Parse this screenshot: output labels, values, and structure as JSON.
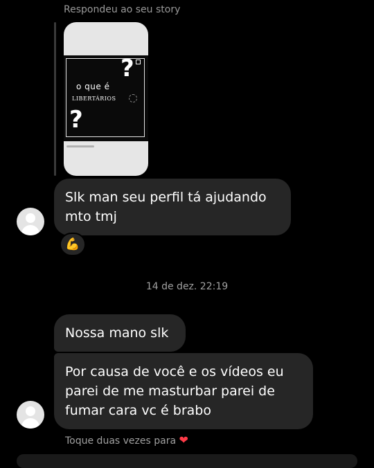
{
  "reply": {
    "label": "Respondeu ao seu story"
  },
  "story": {
    "line1": "o que é",
    "line2": "LIBERTÁRIOS",
    "question_mark": "?",
    "icon": "story-thumbnail"
  },
  "messages": [
    {
      "text": "Slk man seu perfil tá ajudando\nmto tmj"
    },
    {
      "text": "Nossa mano slk"
    },
    {
      "text": "Por causa de você e os vídeos eu\nparei de me masturbar parei de\nfumar cara vc é brabo"
    }
  ],
  "reaction": {
    "emoji": "💪",
    "icon": "flexed-biceps-icon"
  },
  "timestamp": "14 de dez. 22:19",
  "hint": {
    "text": "Toque duas vezes para",
    "heart": "❤",
    "icon": "heart-icon"
  },
  "colors": {
    "background": "#000000",
    "bubble": "#262626",
    "text": "#ffffff",
    "muted_text": "#a0a0a0",
    "heart": "#ff3b48"
  }
}
